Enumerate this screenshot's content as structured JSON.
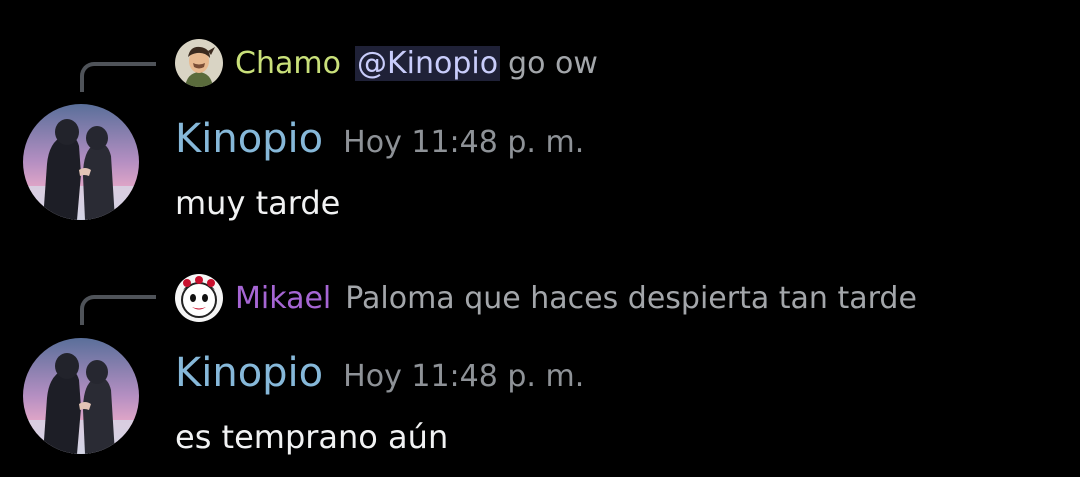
{
  "colors": {
    "background": "#000000",
    "chamo_color": "#c9e07a",
    "mikael_color": "#a666d4",
    "kinopio_color": "#86b8d9",
    "mention_bg": "#1f2137",
    "mention_text": "#c9cdfb",
    "timestamp": "#8e9297",
    "message_text": "#f1f2f3",
    "reply_text": "#a3a6aa"
  },
  "messages": [
    {
      "reply": {
        "author": "Chamo",
        "mention": "@Kinopio",
        "text": "go ow",
        "avatar_icon": "male-character-avatar-icon"
      },
      "author": "Kinopio",
      "timestamp": "Hoy 11:48 p. m.",
      "text": "muy tarde",
      "avatar_icon": "anime-couple-avatar-icon"
    },
    {
      "reply": {
        "author": "Mikael",
        "text": "Paloma que haces despierta tan tarde",
        "avatar_icon": "mime-face-avatar-icon"
      },
      "author": "Kinopio",
      "timestamp": "Hoy 11:48 p. m.",
      "text": "es temprano aún",
      "avatar_icon": "anime-couple-avatar-icon"
    }
  ]
}
